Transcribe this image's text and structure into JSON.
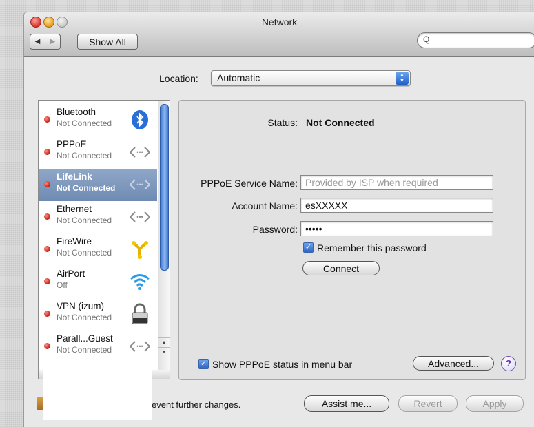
{
  "window": {
    "title": "Network",
    "show_all_label": "Show All",
    "search_glyph": "Q"
  },
  "location": {
    "label": "Location:",
    "value": "Automatic"
  },
  "services": [
    {
      "name": "Bluetooth",
      "status": "Not Connected",
      "icon": "bluetooth-icon",
      "selected": false
    },
    {
      "name": "PPPoE",
      "status": "Not Connected",
      "icon": "ethernet-arrows-icon",
      "selected": false
    },
    {
      "name": "LifeLink",
      "status": "Not Connected",
      "icon": "ethernet-arrows-icon",
      "selected": true
    },
    {
      "name": "Ethernet",
      "status": "Not Connected",
      "icon": "ethernet-arrows-icon",
      "selected": false
    },
    {
      "name": "FireWire",
      "status": "Not Connected",
      "icon": "firewire-icon",
      "selected": false
    },
    {
      "name": "AirPort",
      "status": "Off",
      "icon": "airport-wifi-icon",
      "selected": false
    },
    {
      "name": "VPN (izum)",
      "status": "Not Connected",
      "icon": "vpn-lock-icon",
      "selected": false
    },
    {
      "name": "Parall...Guest",
      "status": "Not Connected",
      "icon": "ethernet-arrows-icon",
      "selected": false
    }
  ],
  "detail": {
    "status_label": "Status:",
    "status_value": "Not Connected",
    "service_name_label": "PPPoE Service Name:",
    "service_name_placeholder": "Provided by ISP when required",
    "account_label": "Account Name:",
    "account_value": "esXXXXX",
    "password_label": "Password:",
    "password_value": "•••••",
    "remember_label": "Remember this password",
    "connect_label": "Connect",
    "show_status_label": "Show PPPoE status in menu bar",
    "advanced_label": "Advanced...",
    "help_label": "?"
  },
  "footer": {
    "lock_text": "event further changes.",
    "assist_label": "Assist me...",
    "revert_label": "Revert",
    "apply_label": "Apply"
  },
  "colors": {
    "selection": "#7a94ba",
    "accent_blue": "#2c66c6",
    "status_red": "#c41d10"
  }
}
